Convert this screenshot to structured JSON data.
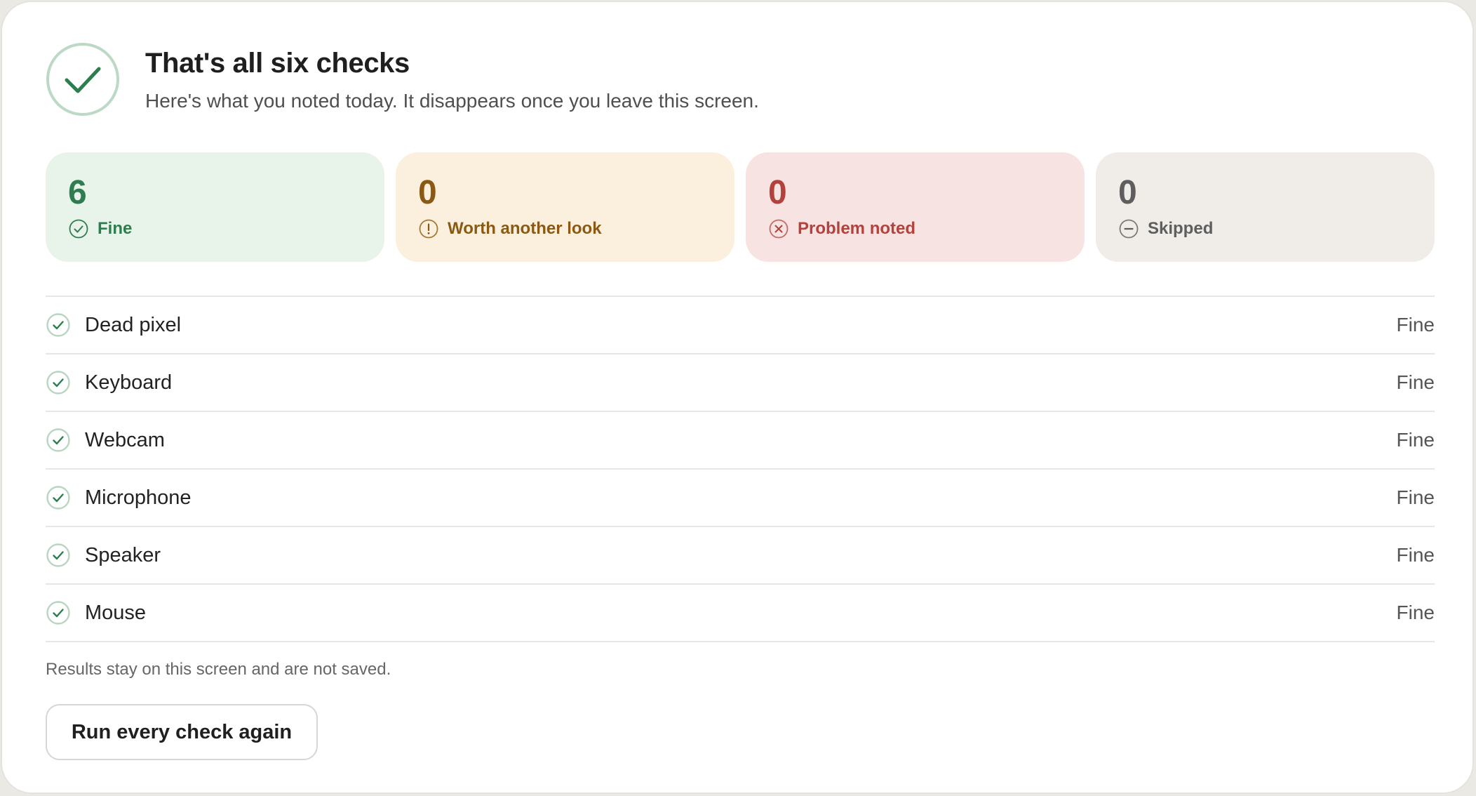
{
  "header": {
    "title": "That's all six checks",
    "subtitle": "Here's what you noted today. It disappears once you leave this screen.",
    "icon": "check-circle-icon"
  },
  "summary": {
    "fine": {
      "count": "6",
      "label": "Fine",
      "icon": "check-circle-icon",
      "color": "#2e7d4e",
      "bg": "#e8f3ea"
    },
    "look": {
      "count": "0",
      "label": "Worth another look",
      "icon": "exclamation-circle-icon",
      "color": "#8a5a14",
      "bg": "#fbf0de"
    },
    "problem": {
      "count": "0",
      "label": "Problem noted",
      "icon": "x-circle-icon",
      "color": "#b3423d",
      "bg": "#f7e3e2"
    },
    "skipped": {
      "count": "0",
      "label": "Skipped",
      "icon": "minus-circle-icon",
      "color": "#5e5e5e",
      "bg": "#f0ede9"
    }
  },
  "results": [
    {
      "name": "Dead pixel",
      "status": "Fine"
    },
    {
      "name": "Keyboard",
      "status": "Fine"
    },
    {
      "name": "Webcam",
      "status": "Fine"
    },
    {
      "name": "Microphone",
      "status": "Fine"
    },
    {
      "name": "Speaker",
      "status": "Fine"
    },
    {
      "name": "Mouse",
      "status": "Fine"
    }
  ],
  "footer": {
    "note": "Results stay on this screen and are not saved.",
    "rerun_label": "Run every check again"
  }
}
